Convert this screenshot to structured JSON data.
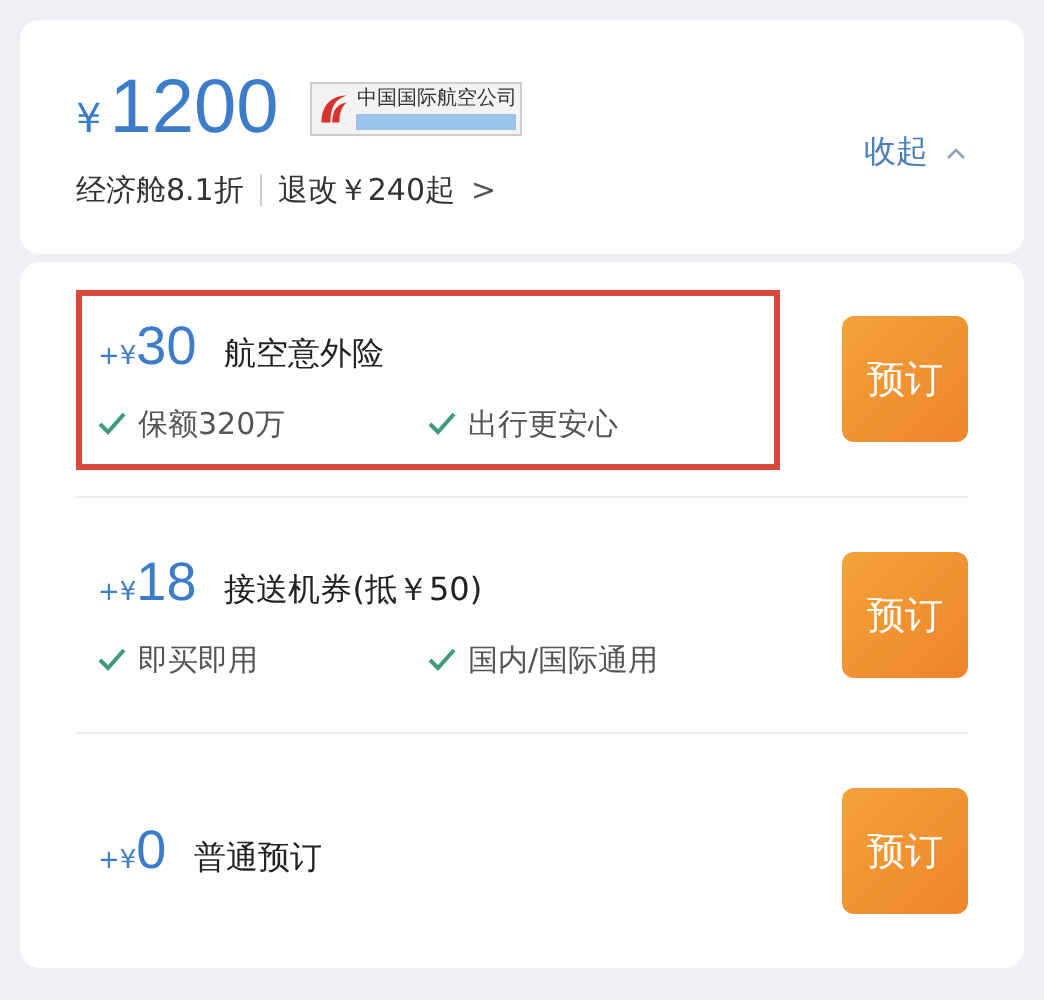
{
  "fare": {
    "currency": "¥",
    "price": "1200",
    "airline_logo_text": "中国国际航空公司",
    "cabin": "经济舱8.1折",
    "refund": "退改￥240起",
    "refund_arrow": ">",
    "collapse": "收起"
  },
  "options": [
    {
      "prefix": "+¥",
      "price": "30",
      "title": "航空意外险",
      "highlighted": true,
      "features": [
        "保额320万",
        "出行更安心"
      ],
      "button": "预订"
    },
    {
      "prefix": "+¥",
      "price": "18",
      "title": "接送机券(抵￥50)",
      "highlighted": false,
      "features": [
        "即买即用",
        "国内/国际通用"
      ],
      "button": "预订"
    },
    {
      "prefix": "+¥",
      "price": "0",
      "title": "普通预订",
      "highlighted": false,
      "button": "预订"
    }
  ]
}
